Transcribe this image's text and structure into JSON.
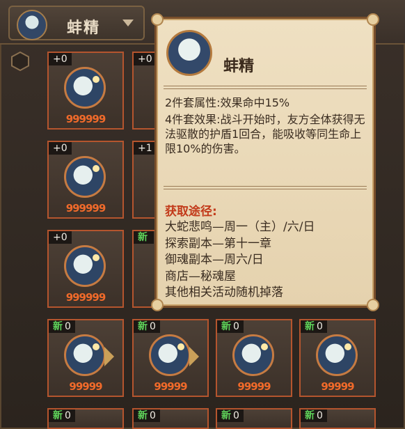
{
  "filter": {
    "label": "蚌精"
  },
  "cards": [
    {
      "badge_new": "",
      "badge_count": "+0",
      "stars": "999999"
    },
    {
      "badge_new": "",
      "badge_count": "+0",
      "stars": "999999"
    },
    {
      "badge_new": "",
      "badge_count": "+0",
      "stars": "999999"
    },
    {
      "badge_new": "新",
      "badge_count": "0",
      "stars": "99999"
    },
    {
      "badge_new": "新",
      "badge_count": "0",
      "stars": "99999"
    },
    {
      "badge_new": "新",
      "badge_count": "0",
      "stars": "99999"
    },
    {
      "badge_new": "新",
      "badge_count": "0",
      "stars": "99999"
    },
    {
      "badge_new": "新",
      "badge_count": "0",
      "stars": ""
    },
    {
      "badge_new": "新",
      "badge_count": "0",
      "stars": ""
    },
    {
      "badge_new": "新",
      "badge_count": "0",
      "stars": ""
    },
    {
      "badge_new": "新",
      "badge_count": "0",
      "stars": ""
    }
  ],
  "partial_cards": [
    {
      "badge": "+0"
    },
    {
      "badge": "+1"
    },
    {
      "badge": "新"
    }
  ],
  "tooltip": {
    "name": "蚌精",
    "set2": "2件套属性:效果命中15%",
    "set4": "4件套效果:战斗开始时，友方全体获得无法驱散的护盾1回合，能吸收等同生命上限10%的伤害。",
    "source_title": "获取途径:",
    "sources": [
      "大蛇悲鸣—周一（主）/六/日",
      "探索副本—第十一章",
      "御魂副本—周六/日",
      "商店—秘魂屋",
      "其他相关活动随机掉落"
    ]
  }
}
